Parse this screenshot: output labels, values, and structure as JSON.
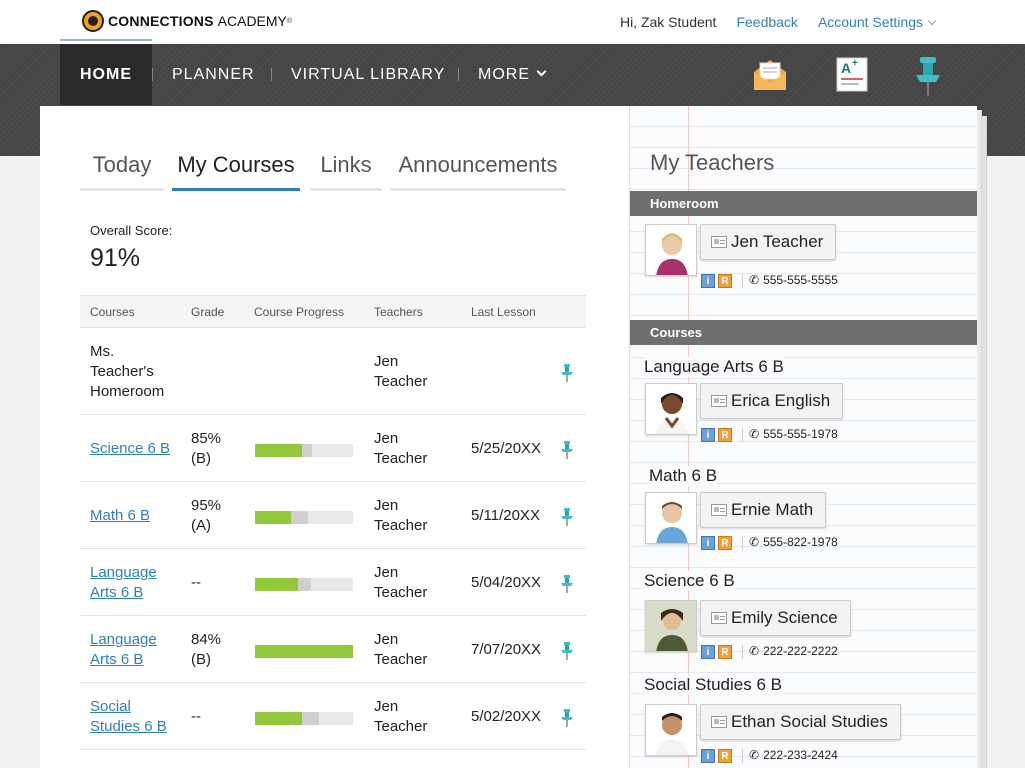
{
  "brand": {
    "name_bold": "CONNECTIONS",
    "name_light": "ACADEMY",
    "mark": "®"
  },
  "top_links": {
    "greeting": "Hi, Zak Student",
    "feedback": "Feedback",
    "account": "Account Settings"
  },
  "nav": {
    "home": "HOME",
    "planner": "PLANNER",
    "library": "VIRTUAL LIBRARY",
    "more": "MORE"
  },
  "nav_icons": [
    "mail-icon",
    "grades-icon",
    "pin-icon"
  ],
  "tabs": [
    {
      "label": "Today",
      "active": false
    },
    {
      "label": "My Courses",
      "active": true
    },
    {
      "label": "Links",
      "active": false
    },
    {
      "label": "Announcements",
      "active": false
    }
  ],
  "score": {
    "label": "Overall Score:",
    "value": "91%"
  },
  "table": {
    "headers": {
      "courses": "Courses",
      "grade": "Grade",
      "progress": "Course Progress",
      "teachers": "Teachers",
      "last_lesson": "Last Lesson"
    },
    "rows": [
      {
        "course_l1": "Ms.",
        "course_l2": "Teacher's",
        "course_l3": "Homeroom",
        "link": false,
        "grade_l1": "",
        "grade_l2": "",
        "progress": null,
        "teacher_l1": "Jen",
        "teacher_l2": "Teacher",
        "last": ""
      },
      {
        "course_l1": "Science 6 B",
        "course_l2": "",
        "course_l3": "",
        "link": true,
        "grade_l1": "85%",
        "grade_l2": "(B)",
        "progress": 0.48,
        "progress_mid": 0.1,
        "teacher_l1": "Jen",
        "teacher_l2": "Teacher",
        "last": "5/25/20XX"
      },
      {
        "course_l1": "Math 6 B",
        "course_l2": "",
        "course_l3": "",
        "link": true,
        "grade_l1": "95%",
        "grade_l2": "(A)",
        "progress": 0.37,
        "progress_mid": 0.17,
        "teacher_l1": "Jen",
        "teacher_l2": "Teacher",
        "last": "5/11/20XX"
      },
      {
        "course_l1": "Language",
        "course_l2": "Arts 6 B",
        "course_l3": "",
        "link": true,
        "grade_l1": "--",
        "grade_l2": "",
        "progress": 0.44,
        "progress_mid": 0.13,
        "teacher_l1": "Jen",
        "teacher_l2": "Teacher",
        "last": "5/04/20XX"
      },
      {
        "course_l1": "Language",
        "course_l2": "Arts 6 B",
        "course_l3": "",
        "link": true,
        "grade_l1": "84%",
        "grade_l2": "(B)",
        "progress": 1.0,
        "progress_mid": 0,
        "teacher_l1": "Jen",
        "teacher_l2": "Teacher",
        "last": "7/07/20XX"
      },
      {
        "course_l1": "Social",
        "course_l2": "Studies 6 B",
        "course_l3": "",
        "link": true,
        "grade_l1": "--",
        "grade_l2": "",
        "progress": 0.48,
        "progress_mid": 0.17,
        "teacher_l1": "Jen",
        "teacher_l2": "Teacher",
        "last": "5/02/20XX"
      }
    ]
  },
  "sidebar": {
    "title": "My Teachers",
    "homeroom_header": "Homeroom",
    "courses_header": "Courses",
    "homeroom_teacher": {
      "name": "Jen Teacher",
      "phone": "555-555-5555"
    },
    "courses": [
      {
        "course": "Language Arts 6 B",
        "teacher": "Erica English",
        "phone": "555-555-1978"
      },
      {
        "course": "Math 6 B",
        "teacher": "Ernie Math",
        "phone": "555-822-1978"
      },
      {
        "course": "Science 6 B",
        "teacher": "Emily Science",
        "phone": "222-222-2222"
      },
      {
        "course": "Social Studies 6 B",
        "teacher": "Ethan Social Studies",
        "phone": "222-233-2424"
      }
    ],
    "mini_info": "i",
    "mini_r": "R"
  },
  "colors": {
    "accent": "#2f7fbf",
    "progress": "#93c83d",
    "nav_bg": "#4a4a4a",
    "header_bar": "#6f6f6f"
  }
}
